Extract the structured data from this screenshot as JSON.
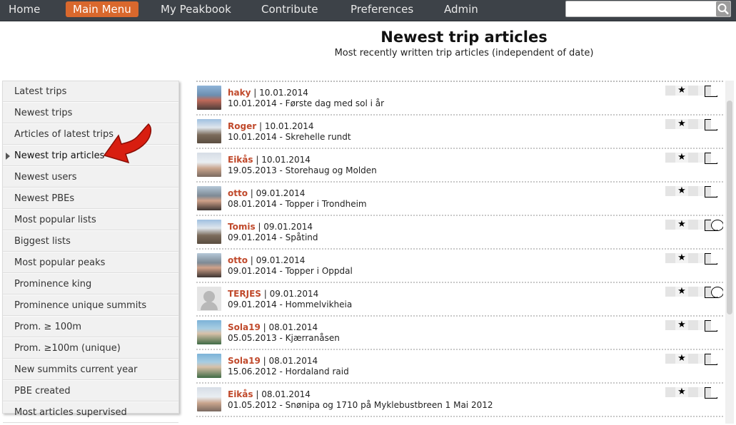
{
  "nav": {
    "items": [
      "Home",
      "Main Menu",
      "My Peakbook",
      "Contribute",
      "Preferences",
      "Admin"
    ],
    "active": "Main Menu",
    "search_value": ""
  },
  "header": {
    "title": "Newest trip articles",
    "subtitle": "Most recently written trip articles (independent of date)"
  },
  "sidebar": {
    "items": [
      "Latest trips",
      "Newest trips",
      "Articles of latest trips",
      "Newest trip articles",
      "Newest users",
      "Newest PBEs",
      "Most popular lists",
      "Biggest lists",
      "Most popular peaks",
      "Prominence king",
      "Prominence unique summits",
      "Prom. ≥ 100m",
      "Prom. ≥100m (unique)",
      "New summits current year",
      "PBE created",
      "Most articles supervised"
    ],
    "selected": "Newest trip articles"
  },
  "articles": [
    {
      "user": "haky",
      "posted": "10.01.2014",
      "trip": "10.01.2014 - Første dag med sol i år",
      "avatar": "av-blue",
      "globe": false
    },
    {
      "user": "Roger",
      "posted": "10.01.2014",
      "trip": "10.01.2014 - Skrehelle rundt",
      "avatar": "av-rock",
      "globe": false
    },
    {
      "user": "Eikås",
      "posted": "10.01.2014",
      "trip": "19.05.2013 - Storehaug og Molden",
      "avatar": "av-snow",
      "globe": false
    },
    {
      "user": "otto",
      "posted": "09.01.2014",
      "trip": "08.01.2014 - Topper i Trondheim",
      "avatar": "av-dark",
      "globe": false
    },
    {
      "user": "Tomis",
      "posted": "09.01.2014",
      "trip": "09.01.2014 - Spåtind",
      "avatar": "av-rock",
      "globe": true
    },
    {
      "user": "otto",
      "posted": "09.01.2014",
      "trip": "09.01.2014 - Topper i Oppdal",
      "avatar": "av-dark",
      "globe": false
    },
    {
      "user": "TERJES",
      "posted": "09.01.2014",
      "trip": "09.01.2014 - Hommelvikheia",
      "avatar": "av-grey",
      "globe": true
    },
    {
      "user": "Sola19",
      "posted": "08.01.2014",
      "trip": "05.05.2013 - Kjærranåsen",
      "avatar": "av-green",
      "globe": false
    },
    {
      "user": "Sola19",
      "posted": "08.01.2014",
      "trip": "15.06.2012 - Hordaland raid",
      "avatar": "av-green",
      "globe": false
    },
    {
      "user": "Eikås",
      "posted": "08.01.2014",
      "trip": "01.05.2012 - Snønipa og 1710 på Myklebustbreen 1 Mai 2012",
      "avatar": "av-snow",
      "globe": false
    }
  ],
  "icons": {
    "star": "★",
    "star_icon": "star-icon",
    "image_icon": "image-icon",
    "globe_icon": "globe-icon",
    "search_icon": "search-icon"
  },
  "colors": {
    "nav_bg": "#3d4248",
    "nav_active": "#d9682d",
    "username": "#c0492b",
    "arrow": "#d81e10"
  }
}
